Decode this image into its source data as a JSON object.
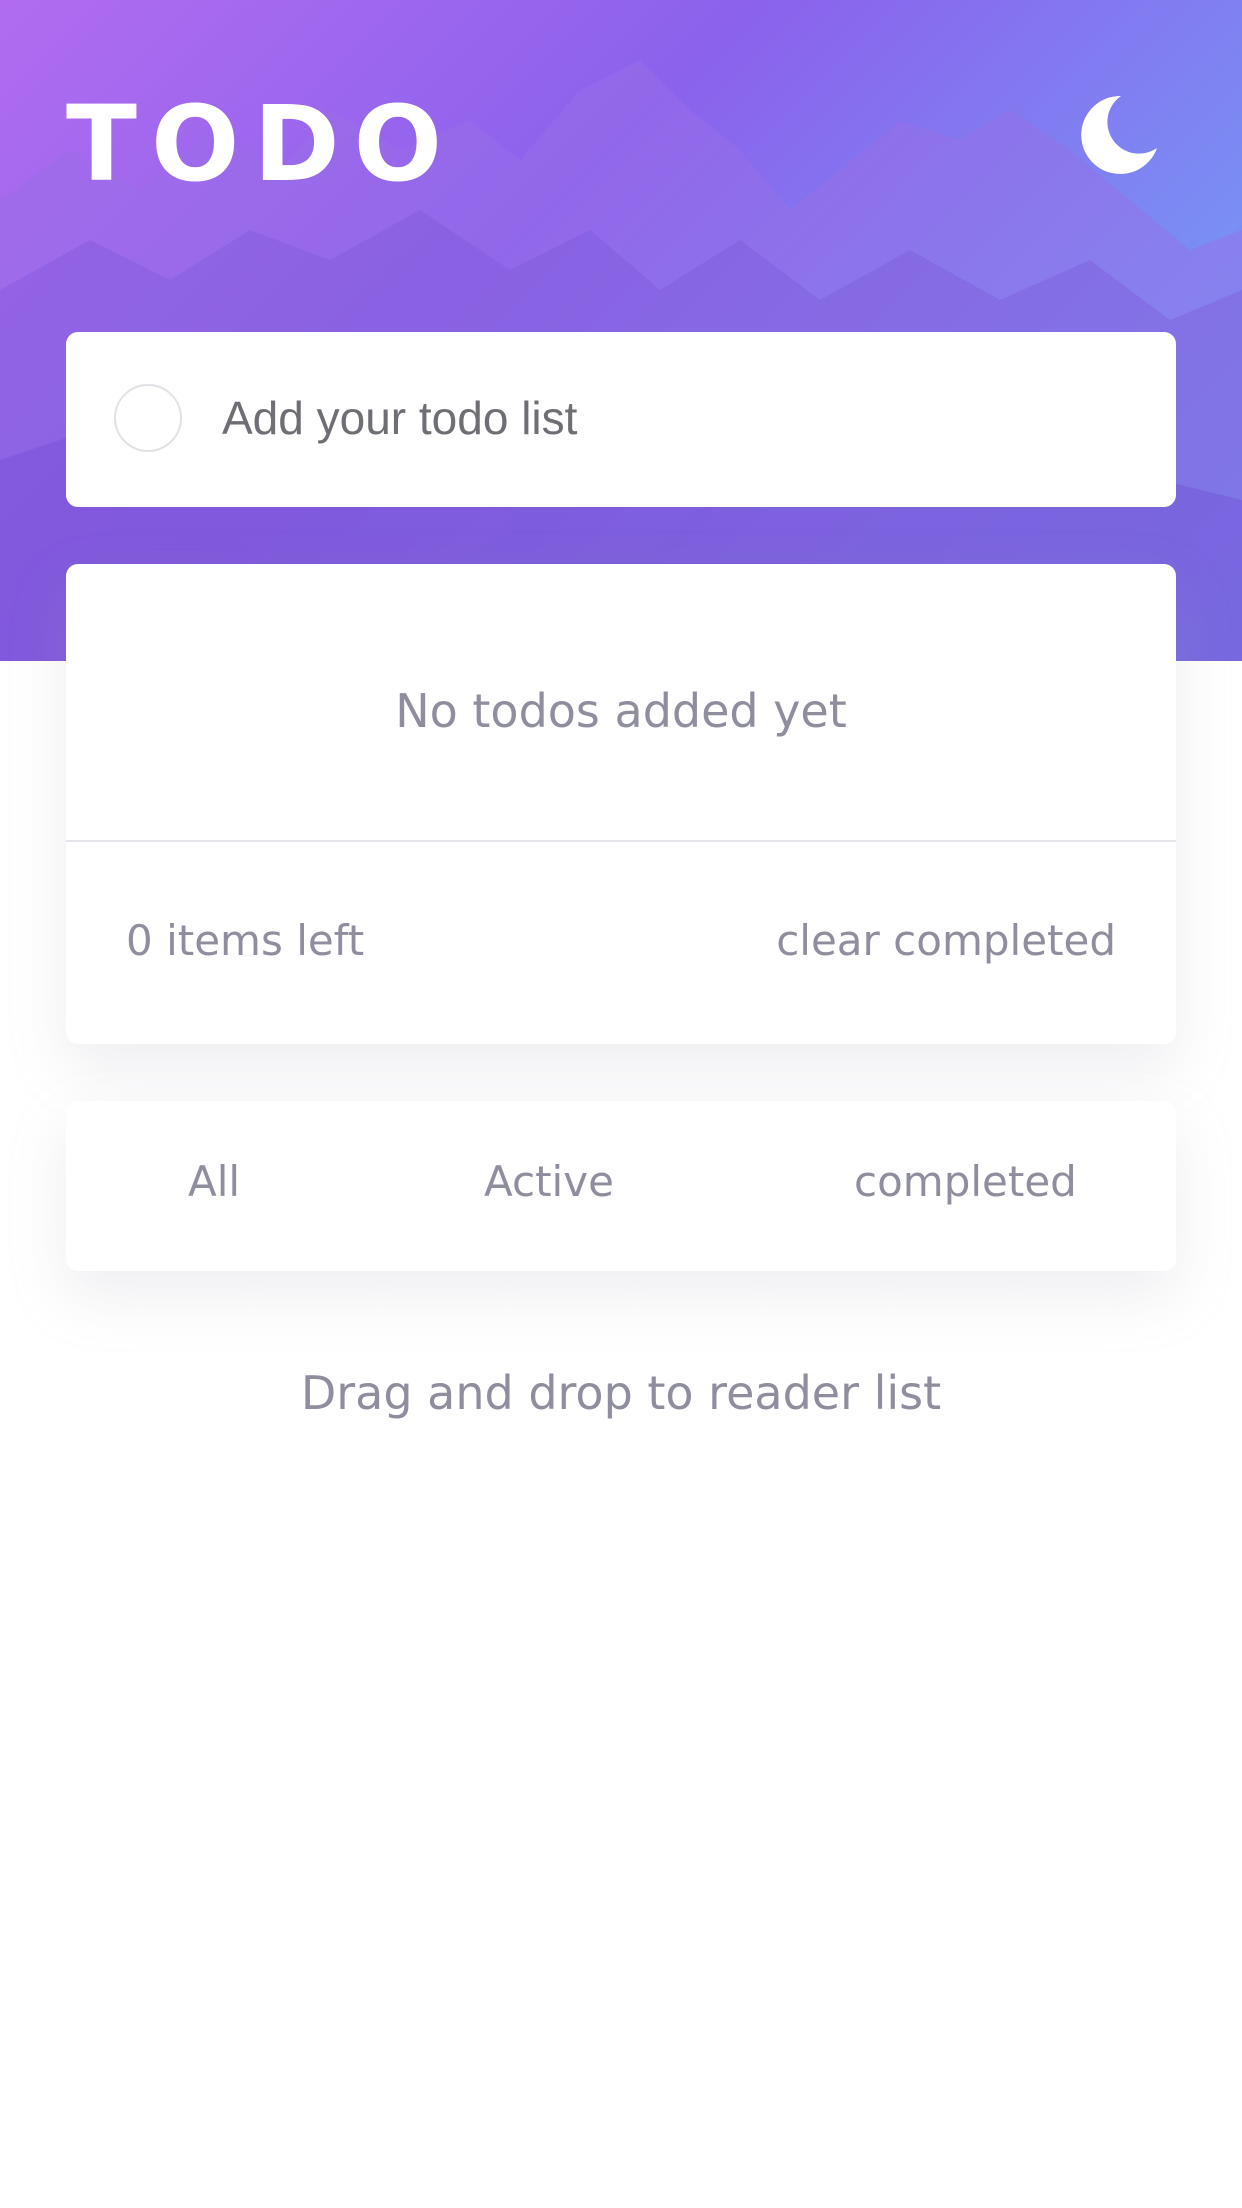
{
  "header": {
    "title": "TODO",
    "theme_toggle_icon": "moon-icon"
  },
  "new_todo": {
    "placeholder": "Add your todo list",
    "value": ""
  },
  "todo_list": {
    "empty_message": "No todos added yet",
    "items_left": "0 items left",
    "clear_completed_label": "clear completed"
  },
  "filters": {
    "all": "All",
    "active": "Active",
    "completed": "completed"
  },
  "footer": {
    "hint": "Drag and drop to reader list"
  },
  "colors": {
    "gradient_start": "#b16cf0",
    "gradient_end": "#67a4fb",
    "muted_text": "#8e8e9e",
    "card_background": "#ffffff"
  }
}
